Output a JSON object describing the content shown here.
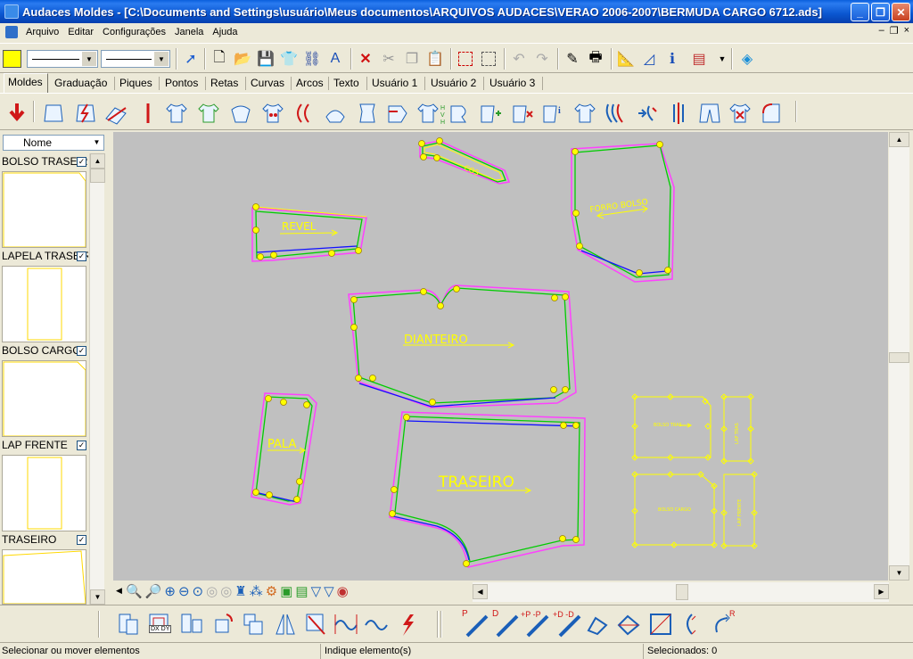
{
  "window": {
    "title": "Audaces Moldes - [C:\\Documents and Settings\\usuário\\Meus documentos\\ARQUIVOS AUDACES\\VERAO 2006-2007\\BERMUDA CARGO 6712.ads]",
    "minimize": "_",
    "maximize": "❐",
    "close": "✕"
  },
  "menu": {
    "items": [
      "Arquivo",
      "Editar",
      "Configurações",
      "Janela",
      "Ajuda"
    ],
    "mdi_minimize": "–",
    "mdi_restore": "❐",
    "mdi_close": "×"
  },
  "toolbar": {
    "fill_color": "#ffff00",
    "icons": [
      "select-pointer",
      "new-file",
      "open-file",
      "save",
      "new-piece",
      "find",
      "font-size",
      "delete",
      "cut",
      "copy",
      "paste",
      "select-rect",
      "select-pointer-rect",
      "undo",
      "redo",
      "edit-piece",
      "print",
      "measure",
      "ruler",
      "info",
      "report",
      "export"
    ]
  },
  "tabs": [
    "Moldes",
    "Graduação",
    "Piques",
    "Pontos",
    "Retas",
    "Curvas",
    "Arcos",
    "Texto",
    "Usuário 1",
    "Usuário 2",
    "Usuário 3"
  ],
  "active_tab": "Moldes",
  "tool_icons": [
    "import-arrow",
    "piece-new",
    "piece-cut",
    "piece-fold",
    "straight-line",
    "shirt-front",
    "shirt-back",
    "shirt-sleeve",
    "collar",
    "piece-mirror",
    "dart",
    "curve",
    "piece-rotate",
    "shirt-body",
    "piece-marker",
    "hvh",
    "piece-join",
    "piece-add",
    "piece-remove",
    "piece-info",
    "piece-sew",
    "seam-allowance",
    "notch",
    "split",
    "pants",
    "piece-delete",
    "piece-corner"
  ],
  "piece_panel": {
    "sort_label": "Nome",
    "items": [
      {
        "name": "BOLSO TRASEIRO",
        "checked": true
      },
      {
        "name": "LAPELA TRASEIRA",
        "checked": true
      },
      {
        "name": "BOLSO CARGO",
        "checked": true
      },
      {
        "name": "LAP FRENTE",
        "checked": true
      },
      {
        "name": "TRASEIRO",
        "checked": true
      }
    ],
    "check_mark": "✓"
  },
  "canvas": {
    "background": "#c0c0c0",
    "labels": {
      "revel": "REVEL",
      "forro_bolso": "FORRO BOLSO",
      "dianteiro": "DIANTEIRO",
      "pala": "PALA",
      "traseiro": "TRASEIRO",
      "bolso_tras": "BOLSO TRAS",
      "bolso_cargo": "BOLSO CARGO",
      "lap_tras": "LAP TRAS",
      "lap_frente": "LAP FRENTE",
      "cos": "COS"
    },
    "colors": {
      "outline": "#ffff00",
      "seam_outer": "#ff40ff",
      "seam_mid": "#00cc00",
      "seam_inner": "#1010ff",
      "point": "#ffff00"
    }
  },
  "view_toolbar": {
    "icons": [
      "zoom",
      "zoom-in",
      "zoom-plus",
      "zoom-minus",
      "zoom-fit",
      "zoom-prev",
      "zoom-next",
      "brush",
      "grid",
      "pieces",
      "piece-green",
      "piece-multi",
      "shirt-blue",
      "shirt-white",
      "view"
    ]
  },
  "edit_toolbar": {
    "icons": [
      "rotate-piece",
      "dx-dy",
      "mirror-piece",
      "rotate",
      "move",
      "mirror-axis",
      "scale",
      "wave-line",
      "sine-curve",
      "lightning"
    ],
    "dx_dy_label": "DX DY",
    "tools": [
      {
        "icon": "point-tool",
        "letter": "P"
      },
      {
        "icon": "distance-tool",
        "letter": "D"
      },
      {
        "icon": "add-point-tool",
        "letter": "+P -P"
      },
      {
        "icon": "add-distance-tool",
        "letter": "+D -D"
      },
      {
        "icon": "curve-tool",
        "letter": ""
      },
      {
        "icon": "arrow-tool",
        "letter": ""
      },
      {
        "icon": "angle-tool",
        "letter": ""
      },
      {
        "icon": "swap-tool",
        "letter": ""
      },
      {
        "icon": "rotate-tool",
        "letter": "R"
      }
    ]
  },
  "status": {
    "left": "Selecionar ou mover elementos",
    "middle": "Indique elemento(s)",
    "right": "Selecionados: 0"
  }
}
